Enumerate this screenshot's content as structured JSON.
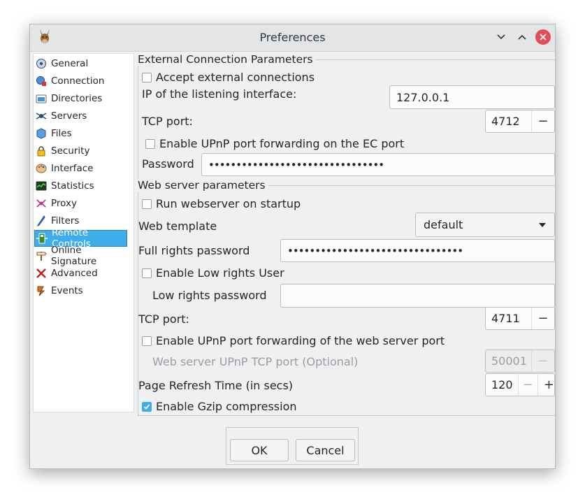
{
  "window": {
    "title": "Preferences"
  },
  "sidebar": {
    "items": [
      {
        "label": "General",
        "icon": "general-icon"
      },
      {
        "label": "Connection",
        "icon": "connection-icon"
      },
      {
        "label": "Directories",
        "icon": "folder-icon"
      },
      {
        "label": "Servers",
        "icon": "servers-icon"
      },
      {
        "label": "Files",
        "icon": "files-icon"
      },
      {
        "label": "Security",
        "icon": "lock-icon"
      },
      {
        "label": "Interface",
        "icon": "palette-icon"
      },
      {
        "label": "Statistics",
        "icon": "statistics-icon"
      },
      {
        "label": "Proxy",
        "icon": "proxy-icon"
      },
      {
        "label": "Filters",
        "icon": "filters-icon"
      },
      {
        "label": "Remote Controls",
        "icon": "remote-controls-icon",
        "selected": true
      },
      {
        "label": "Online Signature",
        "icon": "signpost-icon"
      },
      {
        "label": "Advanced",
        "icon": "advanced-icon"
      },
      {
        "label": "Events",
        "icon": "events-icon"
      }
    ]
  },
  "external": {
    "section_label": "External Connection Parameters",
    "accept_label": "Accept external connections",
    "accept_checked": false,
    "ip_label": "IP of the listening interface:",
    "ip_value": "127.0.0.1",
    "tcp_label": "TCP port:",
    "tcp_value": "4712",
    "upnp_label": "Enable UPnP port forwarding on the EC port",
    "upnp_checked": false,
    "password_label": "Password",
    "password_value": "••••••••••••••••••••••••••••••••"
  },
  "web": {
    "section_label": "Web server parameters",
    "run_label": "Run webserver on startup",
    "run_checked": false,
    "template_label": "Web template",
    "template_value": "default",
    "full_rights_label": "Full rights password",
    "full_rights_value": "••••••••••••••••••••••••••••••••",
    "low_rights_user_label": "Enable Low rights User",
    "low_rights_user_checked": false,
    "low_rights_pw_label": "Low rights password",
    "low_rights_pw_value": "",
    "tcp_label": "TCP port:",
    "tcp_value": "4711",
    "upnp_label": "Enable UPnP port forwarding of the web server port",
    "upnp_checked": false,
    "upnp_port_label": "Web server UPnP TCP port (Optional)",
    "upnp_port_value": "50001",
    "refresh_label": "Page Refresh Time (in secs)",
    "refresh_value": "120",
    "gzip_label": "Enable Gzip compression",
    "gzip_checked": true
  },
  "buttons": {
    "ok": "OK",
    "cancel": "Cancel"
  },
  "colors": {
    "accent": "#3daee9",
    "close": "#e34d55",
    "window_bg": "#eff0f1"
  }
}
